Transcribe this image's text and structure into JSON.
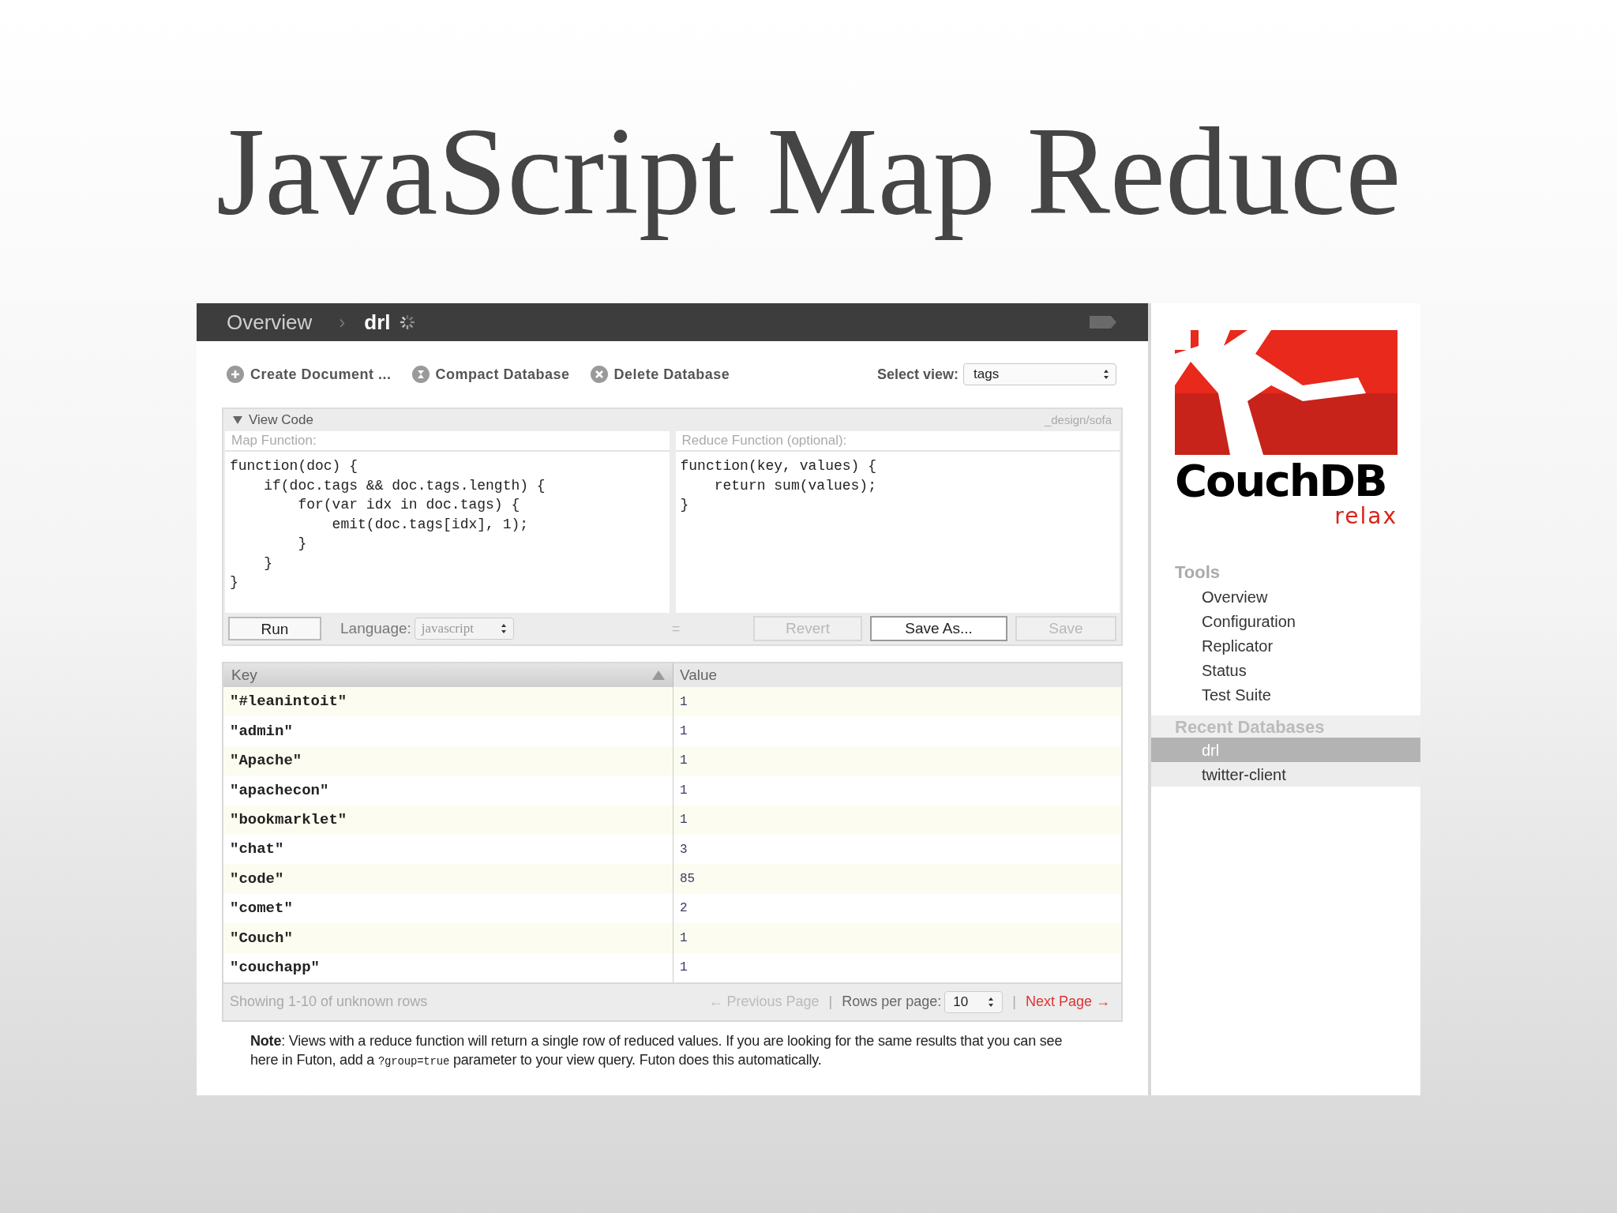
{
  "slide_title": "JavaScript Map Reduce",
  "topbar": {
    "breadcrumbs": [
      "Overview",
      "drl"
    ],
    "separator": "›"
  },
  "toolbar": {
    "actions": [
      {
        "label": "Create Document ...",
        "kind": "create"
      },
      {
        "label": "Compact Database",
        "kind": "compact"
      },
      {
        "label": "Delete Database",
        "kind": "delete"
      }
    ],
    "select_view": {
      "label": "Select view:",
      "value": "tags"
    }
  },
  "view_code": {
    "title": "View Code",
    "expanded": true,
    "design_doc": "_design/sofa",
    "map": {
      "label": "Map Function:",
      "lines": [
        "function(doc) {",
        "    if(doc.tags && doc.tags.length) {",
        "        for(var idx in doc.tags) {",
        "            emit(doc.tags[idx], 1);",
        "        }",
        "    }",
        "}"
      ]
    },
    "reduce": {
      "label": "Reduce Function (optional):",
      "lines": [
        "function(key, values) {",
        "    return sum(values);",
        "}"
      ]
    },
    "run_button": "Run",
    "language": {
      "label": "Language:",
      "value": "javascript"
    },
    "splitter": "=",
    "buttons": [
      {
        "label": "Revert",
        "disabled": true
      },
      {
        "label": "Save As...",
        "disabled": false
      },
      {
        "label": "Save",
        "disabled": true
      }
    ]
  },
  "table": {
    "columns": [
      "Key",
      "Value"
    ],
    "rows": [
      {
        "key": "\"#leanintoit\"",
        "value": "1"
      },
      {
        "key": "\"admin\"",
        "value": "1"
      },
      {
        "key": "\"Apache\"",
        "value": "1"
      },
      {
        "key": "\"apachecon\"",
        "value": "1"
      },
      {
        "key": "\"bookmarklet\"",
        "value": "1"
      },
      {
        "key": "\"chat\"",
        "value": "3"
      },
      {
        "key": "\"code\"",
        "value": "85"
      },
      {
        "key": "\"comet\"",
        "value": "2"
      },
      {
        "key": "\"Couch\"",
        "value": "1"
      },
      {
        "key": "\"couchapp\"",
        "value": "1"
      }
    ],
    "footer": {
      "showing": "Showing 1-10 of unknown rows",
      "previous": "← Previous Page",
      "rows_per_page_label": "Rows per page:",
      "rows_per_page": "10",
      "next": "Next Page →",
      "divider": "|"
    }
  },
  "note": {
    "before": "**Note**: Views with a reduce function will return a single row of reduced values. If you are looking for the same results that you can see here in Futon, add a ",
    "code": "?group=true",
    "after": " parameter to your view query. Futon does this automatically."
  },
  "sidebar": {
    "logo_text": "CouchDB",
    "logo_tagline": "relax",
    "tools_heading": "Tools",
    "tools": [
      "Overview",
      "Configuration",
      "Replicator",
      "Status",
      "Test Suite"
    ],
    "recent_heading": "Recent Databases",
    "recent": [
      {
        "label": "drl",
        "selected": true
      },
      {
        "label": "twitter-client",
        "selected": false
      }
    ]
  }
}
